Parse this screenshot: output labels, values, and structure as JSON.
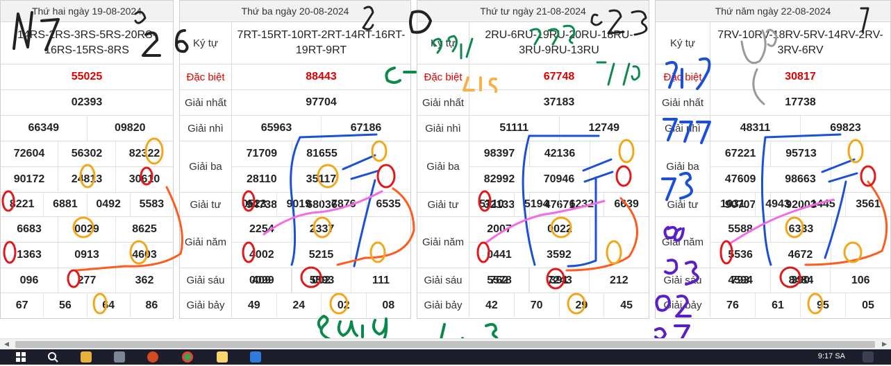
{
  "panels": [
    {
      "date": "Thứ hai ngày 19-08-2024",
      "labels": {
        "kytu": "",
        "db": "",
        "g1": "",
        "g2": "",
        "g3": "",
        "g4": "",
        "g5": "",
        "g6": "",
        "g7": ""
      },
      "kytu": "14RS-2RS-3RS-5RS-20RS-16RS-15RS-8RS",
      "db": "55025",
      "g1": "02393",
      "g2": [
        "66349",
        "09820"
      ],
      "g3": [
        "72604",
        "56302",
        "82322",
        "90172",
        "24813",
        "30610"
      ],
      "g4": [
        "8221",
        "6881",
        "0492",
        "5583"
      ],
      "g5": [
        "6683",
        "0029",
        "8625",
        "1363",
        "0913",
        "4603"
      ],
      "g6": [
        "096",
        "277",
        "362"
      ],
      "g7": [
        "67",
        "56",
        "64",
        "86"
      ]
    },
    {
      "date": "Thứ ba ngày 20-08-2024",
      "labels": {
        "kytu": "Ký tự",
        "db": "Đặc biệt",
        "g1": "Giải nhất",
        "g2": "Giải nhì",
        "g3": "Giải ba",
        "g4": "Giải tư",
        "g5": "Giải năm",
        "g6": "Giải sáu",
        "g7": "Giải bảy"
      },
      "kytu": "7RT-15RT-10RT-2RT-14RT-16RT-19RT-9RT",
      "db": "88443",
      "g1": "97704",
      "g2": [
        "65963",
        "67186"
      ],
      "g3": [
        "71709",
        "81655",
        "28110",
        "35117",
        "94738",
        "68036"
      ],
      "g4": [
        "0523",
        "9019",
        "7876",
        "6535"
      ],
      "g5": [
        "2254",
        "2337",
        "4002",
        "5215",
        "0099",
        "5593"
      ],
      "g6": [
        "409",
        "002",
        "111"
      ],
      "g7": [
        "49",
        "24",
        "02",
        "08"
      ]
    },
    {
      "date": "Thứ tư ngày 21-08-2024",
      "labels": {
        "kytu": "Ký tự",
        "db": "Đặc biệt",
        "g1": "Giải nhất",
        "g2": "Giải nhì",
        "g3": "Giải ba",
        "g4": "Giải tư",
        "g5": "Giải năm",
        "g6": "Giải sáu",
        "g7": "Giải bảy"
      },
      "kytu": "2RU-6RU-19RU-20RU-18RU-3RU-9RU-13RU",
      "db": "67748",
      "g1": "37183",
      "g2": [
        "51111",
        "12749"
      ],
      "g3": [
        "98397",
        "42136",
        "82992",
        "70946",
        "32133",
        "47671"
      ],
      "g4": [
        "5710",
        "5194",
        "6232",
        "6639"
      ],
      "g5": [
        "2007",
        "0022",
        "0441",
        "3592",
        "5578",
        "7243"
      ],
      "g6": [
        "762",
        "391",
        "212"
      ],
      "g7": [
        "42",
        "70",
        "29",
        "45"
      ]
    },
    {
      "date": "Thứ năm ngày 22-08-2024",
      "labels": {
        "kytu": "Ký tự",
        "db": "Đặc biệt",
        "g1": "Giải nhất",
        "g2": "Giải nhì",
        "g3": "Giải ba",
        "g4": "Giải tư",
        "g5": "Giải năm",
        "g6": "Giải sáu",
        "g7": "Giải bảy"
      },
      "kytu": "7RV-10RV-18RV-5RV-14RV-2RV-3RV-6RV",
      "db": "30817",
      "g1": "17738",
      "g2": [
        "48311",
        "69823"
      ],
      "g3": [
        "67221",
        "95713",
        "47609",
        "98663",
        "90707",
        "92003"
      ],
      "g4": [
        "1031",
        "4943",
        "1445",
        "3561"
      ],
      "g5": [
        "5588",
        "6333",
        "5536",
        "4672",
        "4594",
        "8484"
      ],
      "g6": [
        "793",
        "390",
        "106"
      ],
      "g7": [
        "76",
        "61",
        "95",
        "05"
      ]
    }
  ],
  "taskbar": {
    "clock": "9:17 SA"
  },
  "colors": {
    "red": "#e00000",
    "ink_blue": "#1a4fd6",
    "ink_green": "#0a8a4a",
    "ink_orange": "#f08a24",
    "ink_red": "#e01a1a",
    "ink_purple": "#5b1fc9",
    "ink_black": "#222222"
  }
}
